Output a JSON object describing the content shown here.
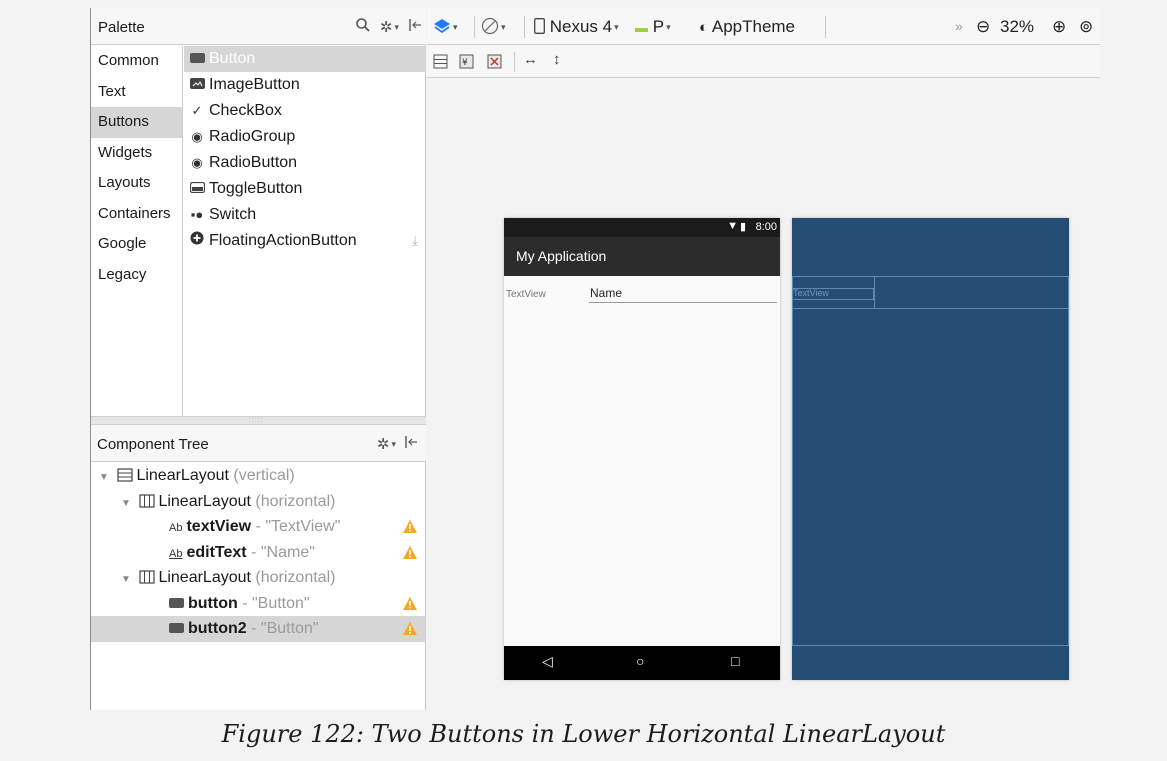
{
  "palette": {
    "title": "Palette",
    "categories": [
      "Common",
      "Text",
      "Buttons",
      "Widgets",
      "Layouts",
      "Containers",
      "Google",
      "Legacy"
    ],
    "selected_category": "Buttons",
    "widgets": [
      {
        "label": "Button",
        "icon": "button-icon"
      },
      {
        "label": "ImageButton",
        "icon": "image-button-icon"
      },
      {
        "label": "CheckBox",
        "icon": "checkmark-icon"
      },
      {
        "label": "RadioGroup",
        "icon": "radio-icon"
      },
      {
        "label": "RadioButton",
        "icon": "radio-icon"
      },
      {
        "label": "ToggleButton",
        "icon": "toggle-button-icon"
      },
      {
        "label": "Switch",
        "icon": "switch-icon"
      },
      {
        "label": "FloatingActionButton",
        "icon": "plus-circle-icon"
      }
    ]
  },
  "tree": {
    "title": "Component Tree",
    "nodes": [
      {
        "name": "LinearLayout",
        "detail": "(vertical)"
      },
      {
        "name": "LinearLayout",
        "detail": "(horizontal)"
      },
      {
        "name": "textView",
        "detail": "- \"TextView\""
      },
      {
        "name": "editText",
        "detail": "- \"Name\""
      },
      {
        "name": "LinearLayout",
        "detail": "(horizontal)"
      },
      {
        "name": "button",
        "detail": "- \"Button\""
      },
      {
        "name": "button2",
        "detail": "- \"Button\""
      }
    ]
  },
  "toolbar": {
    "device": "Nexus 4",
    "api": "P",
    "theme": "AppTheme",
    "zoom": "32%"
  },
  "phone": {
    "time": "8:00",
    "app_title": "My Application",
    "textview": "TextView",
    "edittext": "Name"
  },
  "blueprint": {
    "textview": "TextView"
  },
  "caption": "Figure 122: Two Buttons in Lower Horizontal LinearLayout",
  "colors": {
    "accent": "#2979ff",
    "warning": "#f5a623",
    "blueprint": "#254d73",
    "selection": "#d6d6d6"
  }
}
